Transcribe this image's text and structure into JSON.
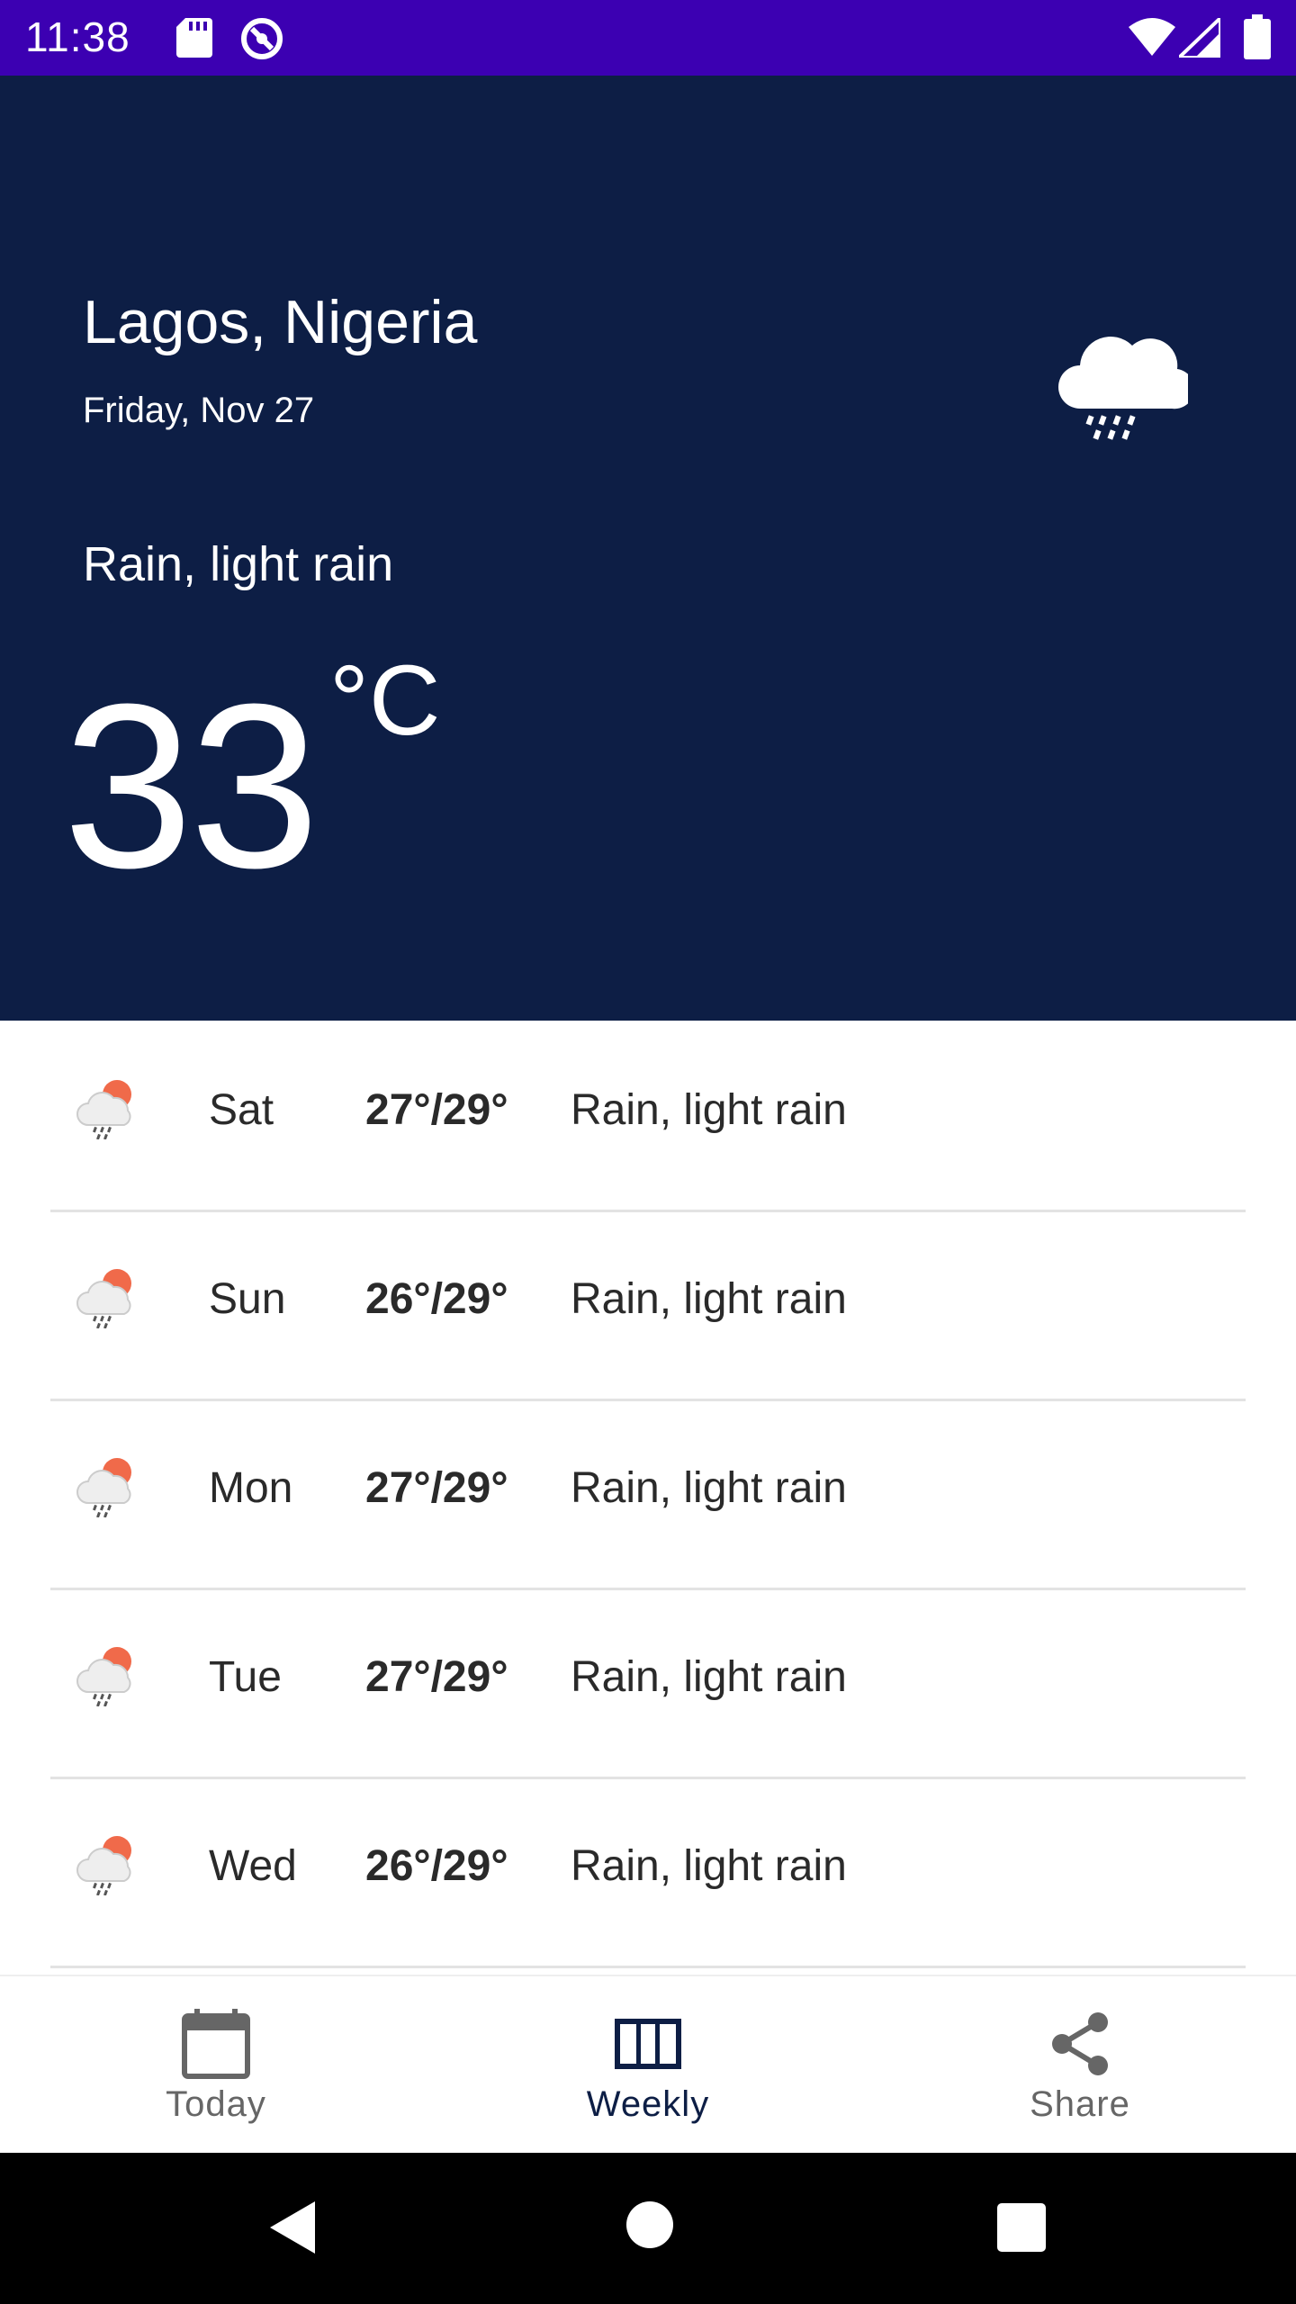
{
  "status_bar": {
    "time": "11:38",
    "icons": [
      "sd-card-icon",
      "sync-icon",
      "wifi-icon",
      "signal-icon",
      "battery-icon"
    ],
    "background": "#3c00b2"
  },
  "current": {
    "location": "Lagos, Nigeria",
    "date": "Friday, Nov 27",
    "condition": "Rain, light rain",
    "temperature": "33",
    "unit": "°C",
    "icon": "rain-cloud-icon",
    "background": "#0d1e45"
  },
  "forecast": [
    {
      "day": "Sat",
      "temps": "27°/29°",
      "desc": "Rain, light rain",
      "icon": "rain-sun-icon"
    },
    {
      "day": "Sun",
      "temps": "26°/29°",
      "desc": "Rain, light rain",
      "icon": "rain-sun-icon"
    },
    {
      "day": "Mon",
      "temps": "27°/29°",
      "desc": "Rain, light rain",
      "icon": "rain-sun-icon"
    },
    {
      "day": "Tue",
      "temps": "27°/29°",
      "desc": "Rain, light rain",
      "icon": "rain-sun-icon"
    },
    {
      "day": "Wed",
      "temps": "26°/29°",
      "desc": "Rain, light rain",
      "icon": "rain-sun-icon"
    }
  ],
  "bottom_nav": {
    "items": [
      {
        "label": "Today",
        "icon": "calendar-icon",
        "active": false
      },
      {
        "label": "Weekly",
        "icon": "columns-icon",
        "active": true
      },
      {
        "label": "Share",
        "icon": "share-icon",
        "active": false
      }
    ]
  },
  "system_nav": [
    "back-icon",
    "home-icon",
    "recent-apps-icon"
  ]
}
